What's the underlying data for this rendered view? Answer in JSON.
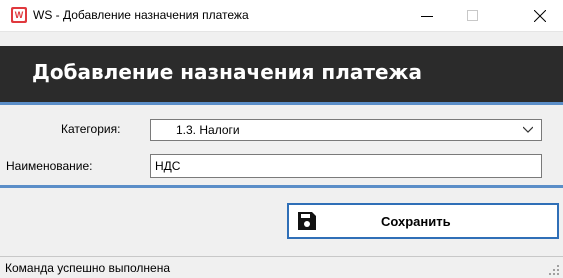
{
  "window": {
    "title": "WS - Добавление назначения платежа",
    "app_icon_letter": "W"
  },
  "header": {
    "title": "Добавление назначения платежа"
  },
  "form": {
    "category_label": "Категория:",
    "category_value": "1.3. Налоги",
    "name_label": "Наименование:",
    "name_value": "НДС"
  },
  "toolbar": {
    "save_label": "Сохранить"
  },
  "status": {
    "text": "Команда успешно выполнена"
  },
  "colors": {
    "header_bg": "#2b2b2b",
    "accent_blue": "#5b8ec8",
    "button_border": "#2f6fb7",
    "app_icon_red": "#e0393e"
  },
  "icons": {
    "app": "app-icon",
    "save": "floppy-disk-icon",
    "dropdown": "chevron-down-icon",
    "minimize": "minimize-icon",
    "maximize": "maximize-icon",
    "close": "close-icon",
    "resize": "resize-grip-icon"
  }
}
